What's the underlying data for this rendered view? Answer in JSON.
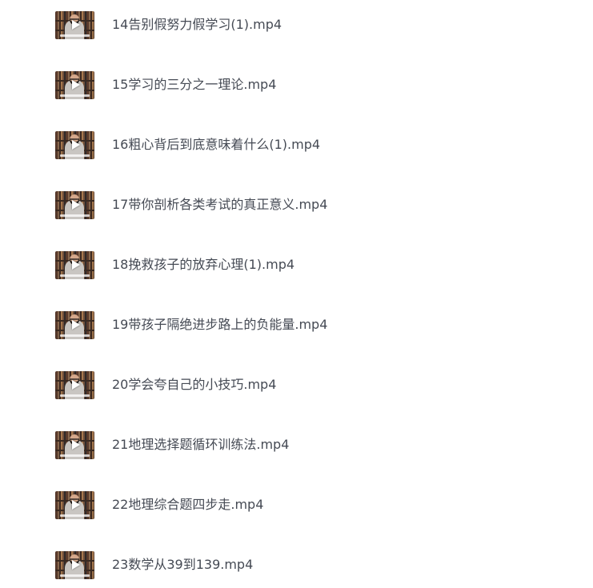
{
  "file_list": {
    "items": [
      {
        "name": "14告别假努力假学习(1).mp4",
        "thumb_icon": "video-thumbnail"
      },
      {
        "name": "15学习的三分之一理论.mp4",
        "thumb_icon": "video-thumbnail"
      },
      {
        "name": "16粗心背后到底意味着什么(1).mp4",
        "thumb_icon": "video-thumbnail"
      },
      {
        "name": "17带你剖析各类考试的真正意义.mp4",
        "thumb_icon": "video-thumbnail"
      },
      {
        "name": "18挽救孩子的放弃心理(1).mp4",
        "thumb_icon": "video-thumbnail"
      },
      {
        "name": "19带孩子隔绝进步路上的负能量.mp4",
        "thumb_icon": "video-thumbnail"
      },
      {
        "name": "20学会夸自己的小技巧.mp4",
        "thumb_icon": "video-thumbnail"
      },
      {
        "name": "21地理选择题循环训练法.mp4",
        "thumb_icon": "video-thumbnail"
      },
      {
        "name": "22地理综合题四步走.mp4",
        "thumb_icon": "video-thumbnail"
      },
      {
        "name": "23数学从39到139.mp4",
        "thumb_icon": "video-thumbnail"
      }
    ]
  },
  "colors": {
    "text": "#454a54",
    "background": "#ffffff",
    "play_icon": "#ffffff"
  }
}
